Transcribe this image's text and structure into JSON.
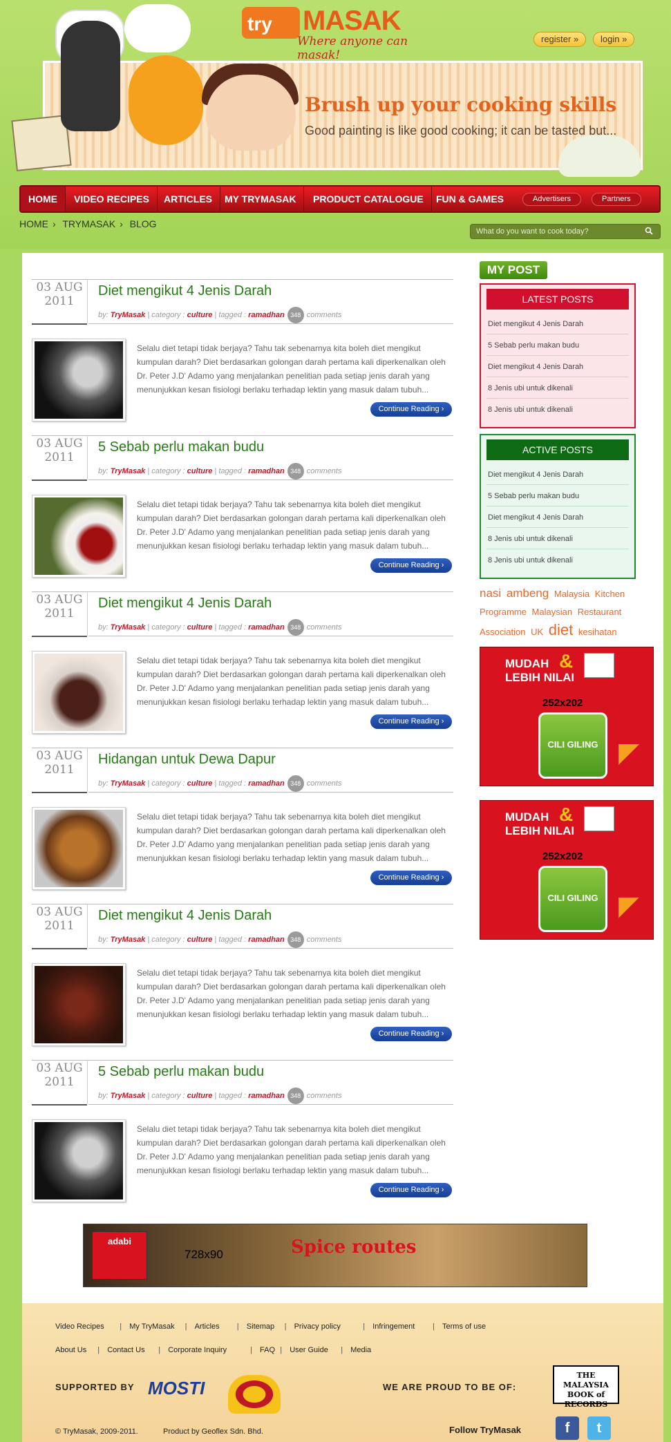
{
  "site": {
    "logo_prefix": "try",
    "logo_main": "MASAK",
    "tagline": "Where anyone can masak!",
    "register_label": "register »",
    "login_label": "login »"
  },
  "banner": {
    "title": "Brush up your cooking skills",
    "subtitle": "Good painting is like good cooking; it can be tasted but..."
  },
  "nav": {
    "items": [
      "HOME",
      "VIDEO RECIPES",
      "ARTICLES",
      "MY TRYMASAK",
      "PRODUCT CATALOGUE",
      "FUN & GAMES"
    ],
    "pills": [
      "Advertisers",
      "Partners"
    ]
  },
  "breadcrumb": [
    "HOME",
    "TRYMASAK",
    "BLOG"
  ],
  "search": {
    "placeholder": "What do you want to cook today?"
  },
  "posts": [
    {
      "day": "03 AUG",
      "year": "2011",
      "title": "Diet mengikut 4 Jenis Darah",
      "author": "TryMasak",
      "category": "culture",
      "tag": "ramadhan",
      "comments": "348",
      "comments_label": "comments",
      "excerpt": "Selalu diet tetapi tidak berjaya? Tahu tak sebenarnya kita boleh diet mengikut kumpulan darah? Diet berdasarkan golongan darah pertama kali diperkenalkan oleh Dr. Peter J.D' Adamo yang menjalankan penelitian pada setiap jenis darah yang menunjukkan kesan fisiologi berlaku terhadap lektin yang masuk dalam tubuh...",
      "button": "Continue Reading"
    },
    {
      "day": "03 AUG",
      "year": "2011",
      "title": "5 Sebab perlu makan budu",
      "author": "TryMasak",
      "category": "culture",
      "tag": "ramadhan",
      "comments": "348",
      "comments_label": "comments",
      "excerpt": "Selalu diet tetapi tidak berjaya? Tahu tak sebenarnya kita boleh diet mengikut kumpulan darah? Diet berdasarkan golongan darah pertama kali diperkenalkan oleh Dr. Peter J.D' Adamo yang menjalankan penelitian pada setiap jenis darah yang menunjukkan kesan fisiologi berlaku terhadap lektin yang masuk dalam tubuh...",
      "button": "Continue Reading"
    },
    {
      "day": "03 AUG",
      "year": "2011",
      "title": "Diet mengikut 4 Jenis Darah",
      "author": "TryMasak",
      "category": "culture",
      "tag": "ramadhan",
      "comments": "348",
      "comments_label": "comments",
      "excerpt": "Selalu diet tetapi tidak berjaya? Tahu tak sebenarnya kita boleh diet mengikut kumpulan darah? Diet berdasarkan golongan darah pertama kali diperkenalkan oleh Dr. Peter J.D' Adamo yang menjalankan penelitian pada setiap jenis darah yang menunjukkan kesan fisiologi berlaku terhadap lektin yang masuk dalam tubuh...",
      "button": "Continue Reading"
    },
    {
      "day": "03 AUG",
      "year": "2011",
      "title": "Hidangan untuk Dewa Dapur",
      "author": "TryMasak",
      "category": "culture",
      "tag": "ramadhan",
      "comments": "348",
      "comments_label": "comments",
      "excerpt": "Selalu diet tetapi tidak berjaya? Tahu tak sebenarnya kita boleh diet mengikut kumpulan darah? Diet berdasarkan golongan darah pertama kali diperkenalkan oleh Dr. Peter J.D' Adamo yang menjalankan penelitian pada setiap jenis darah yang menunjukkan kesan fisiologi berlaku terhadap lektin yang masuk dalam tubuh...",
      "button": "Continue Reading"
    },
    {
      "day": "03 AUG",
      "year": "2011",
      "title": "Diet mengikut 4 Jenis Darah",
      "author": "TryMasak",
      "category": "culture",
      "tag": "ramadhan",
      "comments": "348",
      "comments_label": "comments",
      "excerpt": "Selalu diet tetapi tidak berjaya? Tahu tak sebenarnya kita boleh diet mengikut kumpulan darah? Diet berdasarkan golongan darah pertama kali diperkenalkan oleh Dr. Peter J.D' Adamo yang menjalankan penelitian pada setiap jenis darah yang menunjukkan kesan fisiologi berlaku terhadap lektin yang masuk dalam tubuh...",
      "button": "Continue Reading"
    },
    {
      "day": "03 AUG",
      "year": "2011",
      "title": "5 Sebab perlu makan budu",
      "author": "TryMasak",
      "category": "culture",
      "tag": "ramadhan",
      "comments": "348",
      "comments_label": "comments",
      "excerpt": "Selalu diet tetapi tidak berjaya? Tahu tak sebenarnya kita boleh diet mengikut kumpulan darah? Diet berdasarkan golongan darah pertama kali diperkenalkan oleh Dr. Peter J.D' Adamo yang menjalankan penelitian pada setiap jenis darah yang menunjukkan kesan fisiologi berlaku terhadap lektin yang masuk dalam tubuh...",
      "button": "Continue Reading"
    }
  ],
  "meta_labels": {
    "by": "by:",
    "category": "category :",
    "tagged": "tagged :"
  },
  "sidebar": {
    "my_post": "MY POST",
    "latest_title": "LATEST POSTS",
    "latest": [
      "Diet mengikut 4 Jenis Darah",
      "5 Sebab perlu makan budu",
      "Diet mengikut 4 Jenis Darah",
      "8 Jenis ubi untuk dikenali",
      "8 Jenis ubi untuk dikenali"
    ],
    "active_title": "ACTIVE POSTS",
    "active": [
      "Diet mengikut 4 Jenis Darah",
      "5 Sebab perlu makan budu",
      "Diet mengikut 4 Jenis Darah",
      "8 Jenis ubi untuk dikenali",
      "8 Jenis ubi untuk dikenali"
    ],
    "tags": [
      "nasi",
      "ambeng",
      "Malaysia",
      "Kitchen",
      "Programme",
      "Malaysian",
      "Restaurant",
      "Association",
      "UK",
      "diet",
      "kesihatan"
    ]
  },
  "ads": {
    "headline_1": "MUDAH",
    "headline_amp": "&",
    "headline_2": "LEBIH NILAI",
    "size_label": "252x202",
    "product": "CILI GILING",
    "brand": "adabi"
  },
  "bottom_banner": {
    "size_label": "728x90",
    "brand": "adabi",
    "product": "Spice routes"
  },
  "footer": {
    "links_row1": [
      "Video Recipes",
      "My TryMasak",
      "Articles",
      "Sitemap",
      "Privacy policy",
      "Infringement",
      "Terms of use"
    ],
    "links_row2": [
      "About Us",
      "Contact Us",
      "Corporate Inquiry",
      "FAQ",
      "User Guide",
      "Media"
    ],
    "supported_by": "SUPPORTED BY",
    "mosti": "MOSTI",
    "proud": "WE ARE PROUD TO BE OF:",
    "record_book": "THE MALAYSIA BOOK of RECORDS",
    "copyright": "© TryMasak, 2009-2011.",
    "product_by": "Product by Geoflex Sdn. Bhd.",
    "follow": "Follow TryMasak"
  },
  "colors": {
    "page_bg": "#a8d85e",
    "nav_red": "#c8141c",
    "title_green": "#267a14",
    "meta_red": "#c01726",
    "button_blue": "#163f95",
    "latest_red": "#d0102c",
    "active_green": "#0e6b14",
    "tag_orange": "#e8682a",
    "footer_bg": "#f8e3b2"
  }
}
